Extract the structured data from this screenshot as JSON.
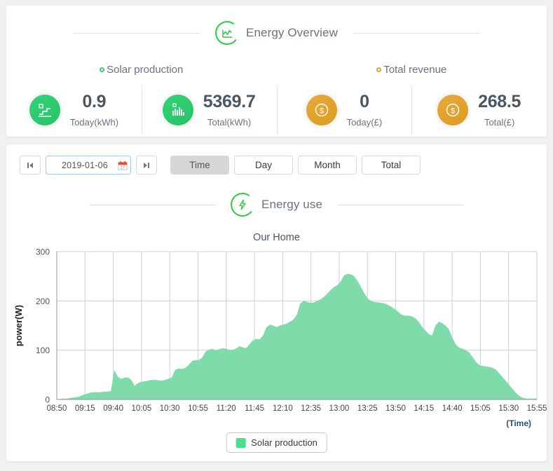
{
  "overview": {
    "title": "Energy Overview",
    "icon": "line-chart-circle-icon",
    "groups": [
      {
        "label": "Solar production",
        "marker_color": "#3ec977"
      },
      {
        "label": "Total revenue",
        "marker_color": "#e0a32e"
      }
    ],
    "stats": [
      {
        "icon": "solar-curve-icon",
        "value": "0.9",
        "label": "Today(kWh)",
        "color": "#2ecc71"
      },
      {
        "icon": "bar-chart-icon",
        "value": "5369.7",
        "label": "Total(kWh)",
        "color": "#2ecc71"
      },
      {
        "icon": "dollar-coin-icon",
        "value": "0",
        "label": "Today(£)",
        "color": "#e2a22c"
      },
      {
        "icon": "dollar-coin-icon",
        "value": "268.5",
        "label": "Total(£)",
        "color": "#e2a22c"
      }
    ]
  },
  "toolbar": {
    "prev_label": "◀",
    "next_label": "▶",
    "date_value": "2019-01-06",
    "date_placeholder": "yyyy-mm-dd",
    "calendar_icon": "calendar-icon",
    "range_buttons": [
      {
        "label": "Time",
        "active": true
      },
      {
        "label": "Day",
        "active": false
      },
      {
        "label": "Month",
        "active": false
      },
      {
        "label": "Total",
        "active": false
      }
    ]
  },
  "energy_use": {
    "title": "Energy use",
    "icon": "lightning-circle-icon"
  },
  "chart_data": {
    "type": "area",
    "title": "Our Home",
    "xlabel": "(Time)",
    "ylabel": "power(W)",
    "ylim": [
      0,
      300
    ],
    "yticks": [
      0,
      100,
      200,
      300
    ],
    "grid": true,
    "legend_position": "bottom",
    "series": [
      {
        "name": "Solar production",
        "color": "#7fdcaa",
        "values": [
          1,
          1,
          2,
          2,
          3,
          4,
          5,
          7,
          10,
          12,
          14,
          15,
          15,
          15,
          16,
          16,
          17,
          60,
          47,
          42,
          44,
          45,
          40,
          28,
          33,
          36,
          37,
          38,
          40,
          40,
          39,
          38,
          40,
          42,
          45,
          60,
          63,
          62,
          64,
          70,
          78,
          80,
          80,
          85,
          97,
          101,
          103,
          100,
          102,
          104,
          103,
          101,
          101,
          103,
          108,
          106,
          104,
          112,
          120,
          123,
          122,
          130,
          146,
          152,
          150,
          147,
          150,
          152,
          154,
          158,
          162,
          172,
          195,
          200,
          198,
          196,
          197,
          200,
          203,
          208,
          215,
          222,
          228,
          232,
          240,
          252,
          255,
          254,
          250,
          240,
          228,
          215,
          205,
          200,
          198,
          197,
          196,
          195,
          192,
          188,
          183,
          178,
          172,
          170,
          170,
          169,
          165,
          158,
          148,
          140,
          133,
          130,
          150,
          158,
          155,
          150,
          142,
          125,
          112,
          105,
          103,
          100,
          95,
          86,
          76,
          70,
          68,
          67,
          66,
          64,
          60,
          52,
          44,
          36,
          28,
          20,
          12,
          6,
          3,
          2,
          2,
          2,
          2
        ]
      }
    ],
    "xticks": [
      "08:50",
      "09:15",
      "09:40",
      "10:05",
      "10:30",
      "10:55",
      "11:20",
      "11:45",
      "12:10",
      "12:35",
      "13:00",
      "13:25",
      "13:50",
      "14:15",
      "14:40",
      "15:05",
      "15:30",
      "15:55"
    ],
    "legend": [
      {
        "label": "Solar production",
        "color": "#4ddd8f"
      }
    ]
  }
}
